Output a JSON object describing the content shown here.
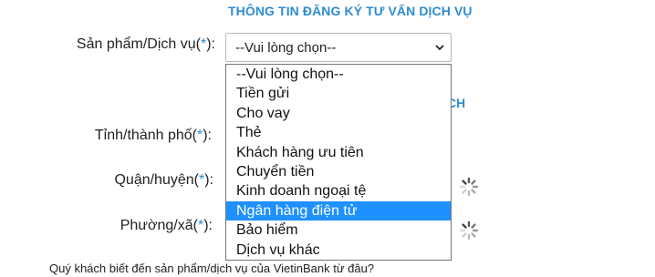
{
  "form": {
    "title": "THÔNG TIN ĐĂNG KÝ TƯ VẤN DỊCH VỤ",
    "hidden_title_fragment": "ICH"
  },
  "fields": {
    "product": {
      "label": "Sản phẩm/Dịch vụ(",
      "required_mark": "*",
      "label_end": "):",
      "selected_value": "--Vui lòng chọn--"
    },
    "province": {
      "label": "Tỉnh/thành phố(",
      "required_mark": "*",
      "label_end": "):"
    },
    "district": {
      "label": "Quận/huyện(",
      "required_mark": "*",
      "label_end": "):"
    },
    "ward": {
      "label": "Phường/xã(",
      "required_mark": "*",
      "label_end": "):"
    }
  },
  "dropdown": {
    "options": [
      "--Vui lòng chọn--",
      "Tiền gửi",
      "Cho vay",
      "Thẻ",
      "Khách hàng ưu tiên",
      "Chuyển tiền",
      "Kinh doanh ngoại tệ",
      "Ngân hàng điện tử",
      "Bảo hiểm",
      "Dịch vụ khác"
    ],
    "highlighted_index": 7
  },
  "question": {
    "text": "Quý khách biết đến sản phẩm/dịch vụ của VietinBank từ đâu?"
  },
  "icons": {
    "chevron": "chevron-down-icon",
    "spinner": "loading-spinner-icon"
  },
  "colors": {
    "accent": "#2e8bd1",
    "highlight": "#1e90ff"
  }
}
